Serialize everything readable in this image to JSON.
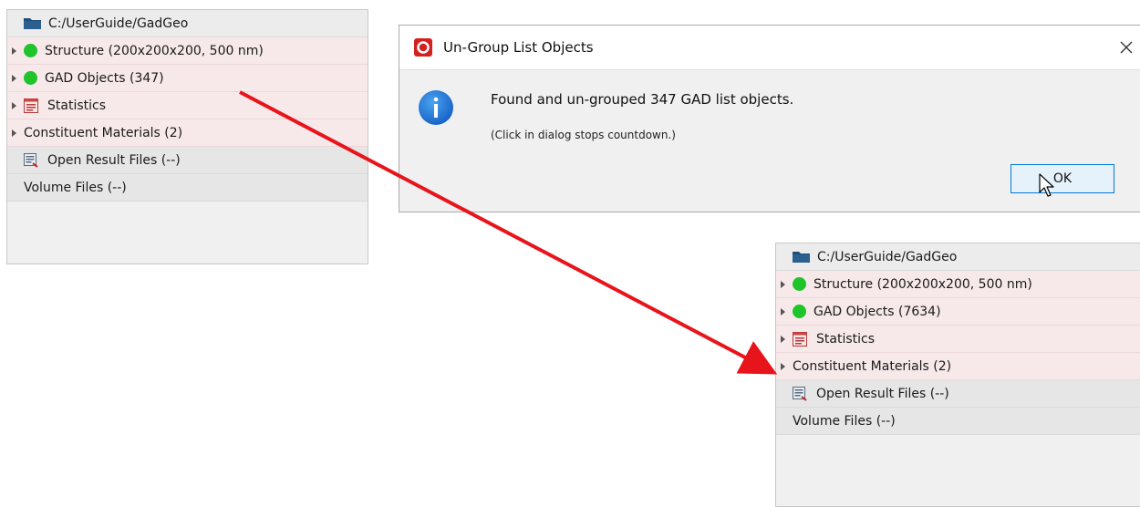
{
  "panel_before": {
    "path": "C:/UserGuide/GadGeo",
    "items": [
      {
        "label": "Structure (200x200x200, 500 nm)"
      },
      {
        "label": "GAD Objects (347)"
      },
      {
        "label": "Statistics"
      },
      {
        "label": "Constituent Materials (2)"
      },
      {
        "label": "Open Result Files (--)"
      },
      {
        "label": "Volume Files (--)"
      }
    ]
  },
  "panel_after": {
    "path": "C:/UserGuide/GadGeo",
    "items": [
      {
        "label": "Structure (200x200x200, 500 nm)"
      },
      {
        "label": "GAD Objects (7634)"
      },
      {
        "label": "Statistics"
      },
      {
        "label": "Constituent Materials (2)"
      },
      {
        "label": "Open Result Files (--)"
      },
      {
        "label": "Volume Files (--)"
      }
    ]
  },
  "dialog": {
    "title": "Un-Group List Objects",
    "message": "Found and un-grouped 347 GAD list objects.",
    "hint": "(Click in dialog stops countdown.)",
    "ok_label": "OK"
  },
  "colors": {
    "status_green": "#1ec42a",
    "row_pink": "#f7e9ea",
    "annotation_red": "#e8141b",
    "info_blue": "#1a74d8",
    "button_border": "#0078d7"
  },
  "icons": {
    "folder": "folder-icon",
    "status": "status-dot-icon",
    "statistics": "statistics-icon",
    "results": "result-files-icon",
    "info": "info-icon",
    "close": "close-icon"
  }
}
